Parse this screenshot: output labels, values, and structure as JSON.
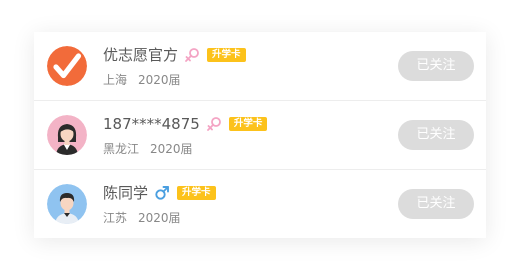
{
  "users": [
    {
      "name": "优志愿官方",
      "gender_icon": "female-symbol-icon",
      "gender_color": "#f4a4c4",
      "badge": "升学卡",
      "region": "上海",
      "year": "2020届",
      "follow_label": "已关注",
      "avatar_icon": "checkmark-logo-icon"
    },
    {
      "name": "187****4875",
      "gender_icon": "female-symbol-icon",
      "gender_color": "#f4a4c4",
      "badge": "升学卡",
      "region": "黑龙江",
      "year": "2020届",
      "follow_label": "已关注",
      "avatar_icon": "female-avatar-icon"
    },
    {
      "name": "陈同学",
      "gender_icon": "male-symbol-icon",
      "gender_color": "#4a9fe0",
      "badge": "升学卡",
      "region": "江苏",
      "year": "2020届",
      "follow_label": "已关注",
      "avatar_icon": "male-avatar-icon"
    }
  ],
  "colors": {
    "badge": "#fcc21b",
    "follow_button": "#dcdcdc",
    "logo_avatar": "#f26b3a",
    "female_avatar_bg": "#f3b3c6",
    "male_avatar_bg": "#8fc3f0"
  }
}
